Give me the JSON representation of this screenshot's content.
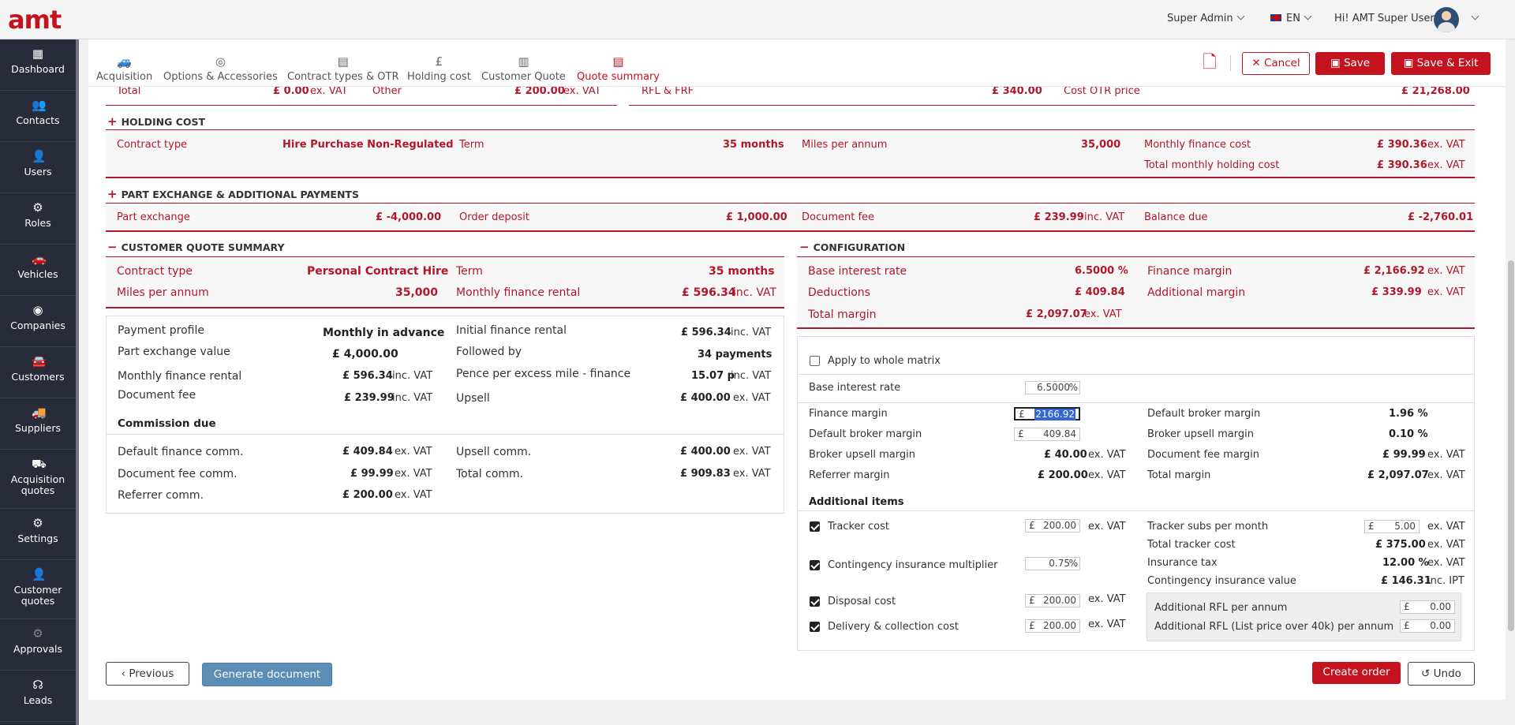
{
  "app": {
    "logo": "amt"
  },
  "header": {
    "role": "Super Admin",
    "lang": "EN",
    "greeting": "Hi! AMT Super User"
  },
  "sidebar": {
    "items": [
      {
        "label": "Dashboard",
        "icon": "dashboard-icon"
      },
      {
        "label": "Contacts",
        "icon": "contacts-icon"
      },
      {
        "label": "Users",
        "icon": "user-icon"
      },
      {
        "label": "Roles",
        "icon": "roles-icon"
      },
      {
        "label": "Vehicles",
        "icon": "car-icon"
      },
      {
        "label": "Companies",
        "icon": "companies-icon"
      },
      {
        "label": "Customers",
        "icon": "customers-icon"
      },
      {
        "label": "Suppliers",
        "icon": "suppliers-icon"
      },
      {
        "label": "Acquisition quotes",
        "icon": "acquisition-icon"
      },
      {
        "label": "Settings",
        "icon": "gear-icon"
      },
      {
        "label": "Customer quotes",
        "icon": "customer-quotes-icon"
      },
      {
        "label": "Approvals",
        "icon": "approvals-icon"
      },
      {
        "label": "Leads",
        "icon": "headset-icon"
      }
    ]
  },
  "tabs": [
    "Acquisition",
    "Options & Accessories",
    "Contract types & OTR",
    "Holding cost",
    "Customer Quote",
    "Quote summary"
  ],
  "actions": {
    "cancel": "Cancel",
    "save": "Save",
    "save_exit": "Save & Exit"
  },
  "top_row": {
    "total_label": "Total",
    "total_value": "£ 0.00",
    "total_unit": "ex. VAT",
    "other_label": "Other",
    "other_value": "£ 200.00",
    "other_unit": "ex. VAT",
    "rfl_label": "RFL & FRF",
    "rfl_value": "£ 340.00",
    "cost_otr_label": "Cost OTR price",
    "cost_otr_value": "£ 21,268.00"
  },
  "holding": {
    "title": "HOLDING COST",
    "contract_type_label": "Contract type",
    "contract_type": "Hire Purchase Non-Regulated",
    "term_label": "Term",
    "term": "35 months",
    "miles_label": "Miles per annum",
    "miles": "35,000",
    "mfc_label": "Monthly finance cost",
    "mfc": "£ 390.36",
    "mfc_unit": "ex. VAT",
    "tmhc_label": "Total monthly holding cost",
    "tmhc": "£ 390.36",
    "tmhc_unit": "ex. VAT"
  },
  "partex": {
    "title": "PART EXCHANGE & ADDITIONAL PAYMENTS",
    "px_label": "Part exchange",
    "px": "£ -4,000.00",
    "od_label": "Order deposit",
    "od": "£ 1,000.00",
    "df_label": "Document fee",
    "df": "£ 239.99",
    "df_unit": "inc. VAT",
    "bd_label": "Balance due",
    "bd": "£ -2,760.01"
  },
  "cqs": {
    "title": "CUSTOMER QUOTE SUMMARY",
    "contract_type_label": "Contract type",
    "contract_type": "Personal Contract Hire",
    "term_label": "Term",
    "term": "35 months",
    "miles_label": "Miles per annum",
    "miles": "35,000",
    "mfr_label": "Monthly finance rental",
    "mfr": "£ 596.34",
    "mfr_unit": "inc. VAT",
    "details": {
      "pp_label": "Payment profile",
      "pp": "Monthly in advance",
      "pxv_label": "Part exchange value",
      "pxv": "£ 4,000.00",
      "mfr_label": "Monthly finance rental",
      "mfr": "£ 596.34",
      "mfr_unit": "inc. VAT",
      "df_label": "Document fee",
      "df": "£ 239.99",
      "df_unit": "inc. VAT",
      "ifr_label": "Initial finance rental",
      "ifr": "£ 596.34",
      "ifr_unit": "inc. VAT",
      "fb_label": "Followed by",
      "fb": "34 payments",
      "ppem_label": "Pence per excess mile - finance",
      "ppem": "15.07 p",
      "ppem_unit": "inc. VAT",
      "upsell_label": "Upsell",
      "upsell": "£ 400.00",
      "upsell_unit": "ex. VAT"
    },
    "commission": {
      "title": "Commission due",
      "dfc_label": "Default finance comm.",
      "dfc": "£ 409.84",
      "dfc_unit": "ex. VAT",
      "dfee_label": "Document fee comm.",
      "dfee": "£ 99.99",
      "dfee_unit": "ex. VAT",
      "ref_label": "Referrer comm.",
      "ref": "£ 200.00",
      "ref_unit": "ex. VAT",
      "up_label": "Upsell comm.",
      "up": "£ 400.00",
      "up_unit": "ex. VAT",
      "tot_label": "Total comm.",
      "tot": "£ 909.83",
      "tot_unit": "ex. VAT"
    }
  },
  "config": {
    "title": "CONFIGURATION",
    "bir_label": "Base interest rate",
    "bir": "6.5000 %",
    "fm_label": "Finance margin",
    "fm": "£ 2,166.92",
    "fm_unit": "ex. VAT",
    "ded_label": "Deductions",
    "ded": "£ 409.84",
    "am_label": "Additional margin",
    "am": "£ 339.99",
    "am_unit": "ex. VAT",
    "tm_label": "Total margin",
    "tm": "£ 2,097.07",
    "tm_unit": "ex. VAT",
    "apply_label": "Apply to whole matrix",
    "bir_in_label": "Base interest rate",
    "bir_in": "6.5000",
    "pct": "%",
    "fm_in_label": "Finance margin",
    "fm_in": "2166.92",
    "cur": "£",
    "dbm_in_label": "Default broker margin",
    "dbm_in": "409.84",
    "bum_label": "Broker upsell margin",
    "bum": "£ 40.00",
    "bum_unit": "ex. VAT",
    "refm_label": "Referrer margin",
    "refm": "£ 200.00",
    "refm_unit": "ex. VAT",
    "dbm_pct_label": "Default broker margin",
    "dbm_pct": "1.96 %",
    "bum_pct_label": "Broker upsell margin",
    "bum_pct": "0.10 %",
    "dfm_label": "Document fee margin",
    "dfm": "£ 99.99",
    "dfm_unit": "ex. VAT",
    "tm2_label": "Total margin",
    "tm2": "£ 2,097.07",
    "tm2_unit": "ex. VAT",
    "additional_title": "Additional items",
    "tracker_label": "Tracker cost",
    "tracker": "200.00",
    "tracker_unit": "ex. VAT",
    "cim_label": "Contingency insurance multiplier",
    "cim": "0.75",
    "disposal_label": "Disposal cost",
    "disposal": "200.00",
    "disposal_unit": "ex. VAT",
    "delivery_label": "Delivery & collection cost",
    "delivery": "200.00",
    "delivery_unit": "ex. VAT",
    "tspm_label": "Tracker subs per month",
    "tspm": "5.00",
    "tspm_unit": "ex. VAT",
    "ttc_label": "Total tracker cost",
    "ttc": "£ 375.00",
    "ttc_unit": "ex. VAT",
    "it_label": "Insurance tax",
    "it": "12.00 %",
    "it_unit": "ex. VAT",
    "civ_label": "Contingency insurance value",
    "civ": "£ 146.31",
    "civ_unit": "inc. IPT",
    "arfl_label": "Additional RFL per annum",
    "arfl": "0.00",
    "arfl40_label": "Additional RFL (List price over 40k) per annum",
    "arfl40": "0.00"
  },
  "footer": {
    "previous": "Previous",
    "generate": "Generate document",
    "create_order": "Create order",
    "undo": "Undo"
  }
}
